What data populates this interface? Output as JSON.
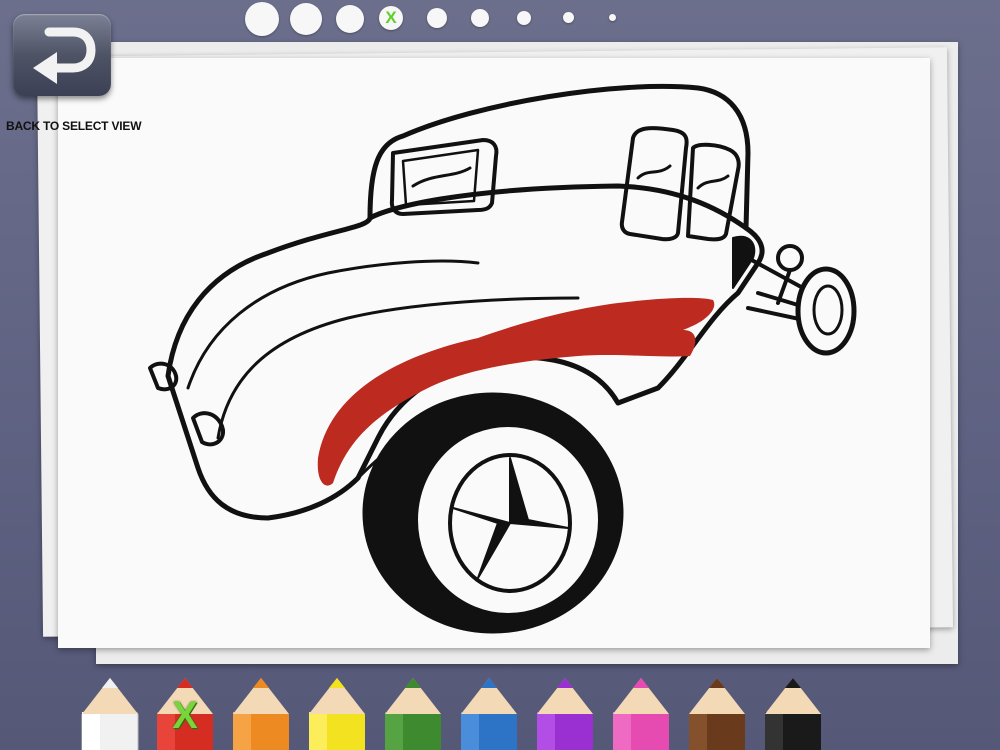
{
  "back_button": {
    "label": "BACK TO SELECT VIEW",
    "icon": "undo-arrow-icon"
  },
  "page_indicator": {
    "total": 9,
    "current_index": 3,
    "current_mark": "X"
  },
  "canvas": {
    "subject": "hot-rod-car-outline",
    "painted_stroke_color": "#bc2a20"
  },
  "palette": {
    "selected_index": 1,
    "selected_mark": "X",
    "colors": [
      {
        "name": "white",
        "hex": "#f1f1f1"
      },
      {
        "name": "red",
        "hex": "#d62d22"
      },
      {
        "name": "orange",
        "hex": "#ee8a22"
      },
      {
        "name": "yellow",
        "hex": "#f3e21f"
      },
      {
        "name": "green",
        "hex": "#3e8a2e"
      },
      {
        "name": "blue",
        "hex": "#2d74c7"
      },
      {
        "name": "purple",
        "hex": "#9a2fd2"
      },
      {
        "name": "pink",
        "hex": "#e54bb0"
      },
      {
        "name": "brown",
        "hex": "#6a3a1c"
      },
      {
        "name": "black",
        "hex": "#1a1a1a"
      }
    ]
  }
}
